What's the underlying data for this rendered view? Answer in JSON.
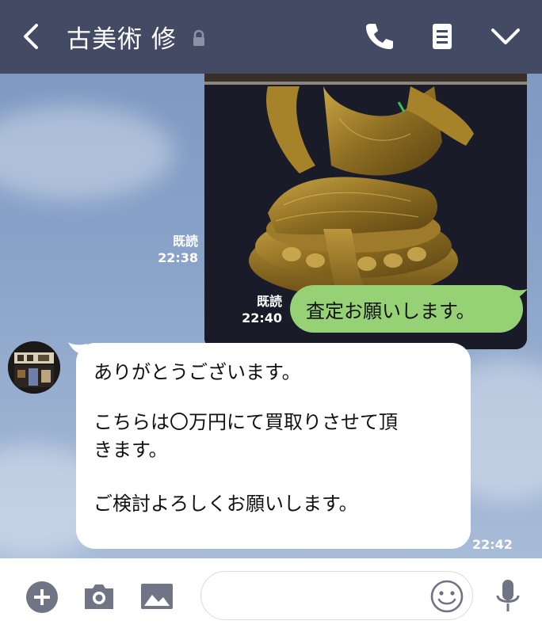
{
  "header": {
    "title": "古美術 修",
    "icons": [
      "back-icon",
      "lock-icon",
      "phone-icon",
      "notes-icon",
      "chevron-down-icon"
    ]
  },
  "messages": {
    "photo": {
      "read": "既読",
      "time": "22:38"
    },
    "sent": {
      "text": "査定お願いします。",
      "read": "既読",
      "time": "22:40"
    },
    "received": {
      "lines": [
        "ありがとうございます。",
        "",
        "こちらは〇万円にて買取りさせて頂",
        "きます。",
        "",
        "ご検討よろしくお願いします。"
      ],
      "time": "22:42"
    }
  },
  "footer": {
    "icons": [
      "plus-icon",
      "camera-icon",
      "image-icon",
      "emoji-icon",
      "microphone-icon"
    ],
    "input_placeholder": ""
  },
  "colors": {
    "header_bg": "#434a63",
    "chat_bg": "#8aa0c4",
    "sent_bubble": "#97d176",
    "received_bubble": "#ffffff"
  }
}
